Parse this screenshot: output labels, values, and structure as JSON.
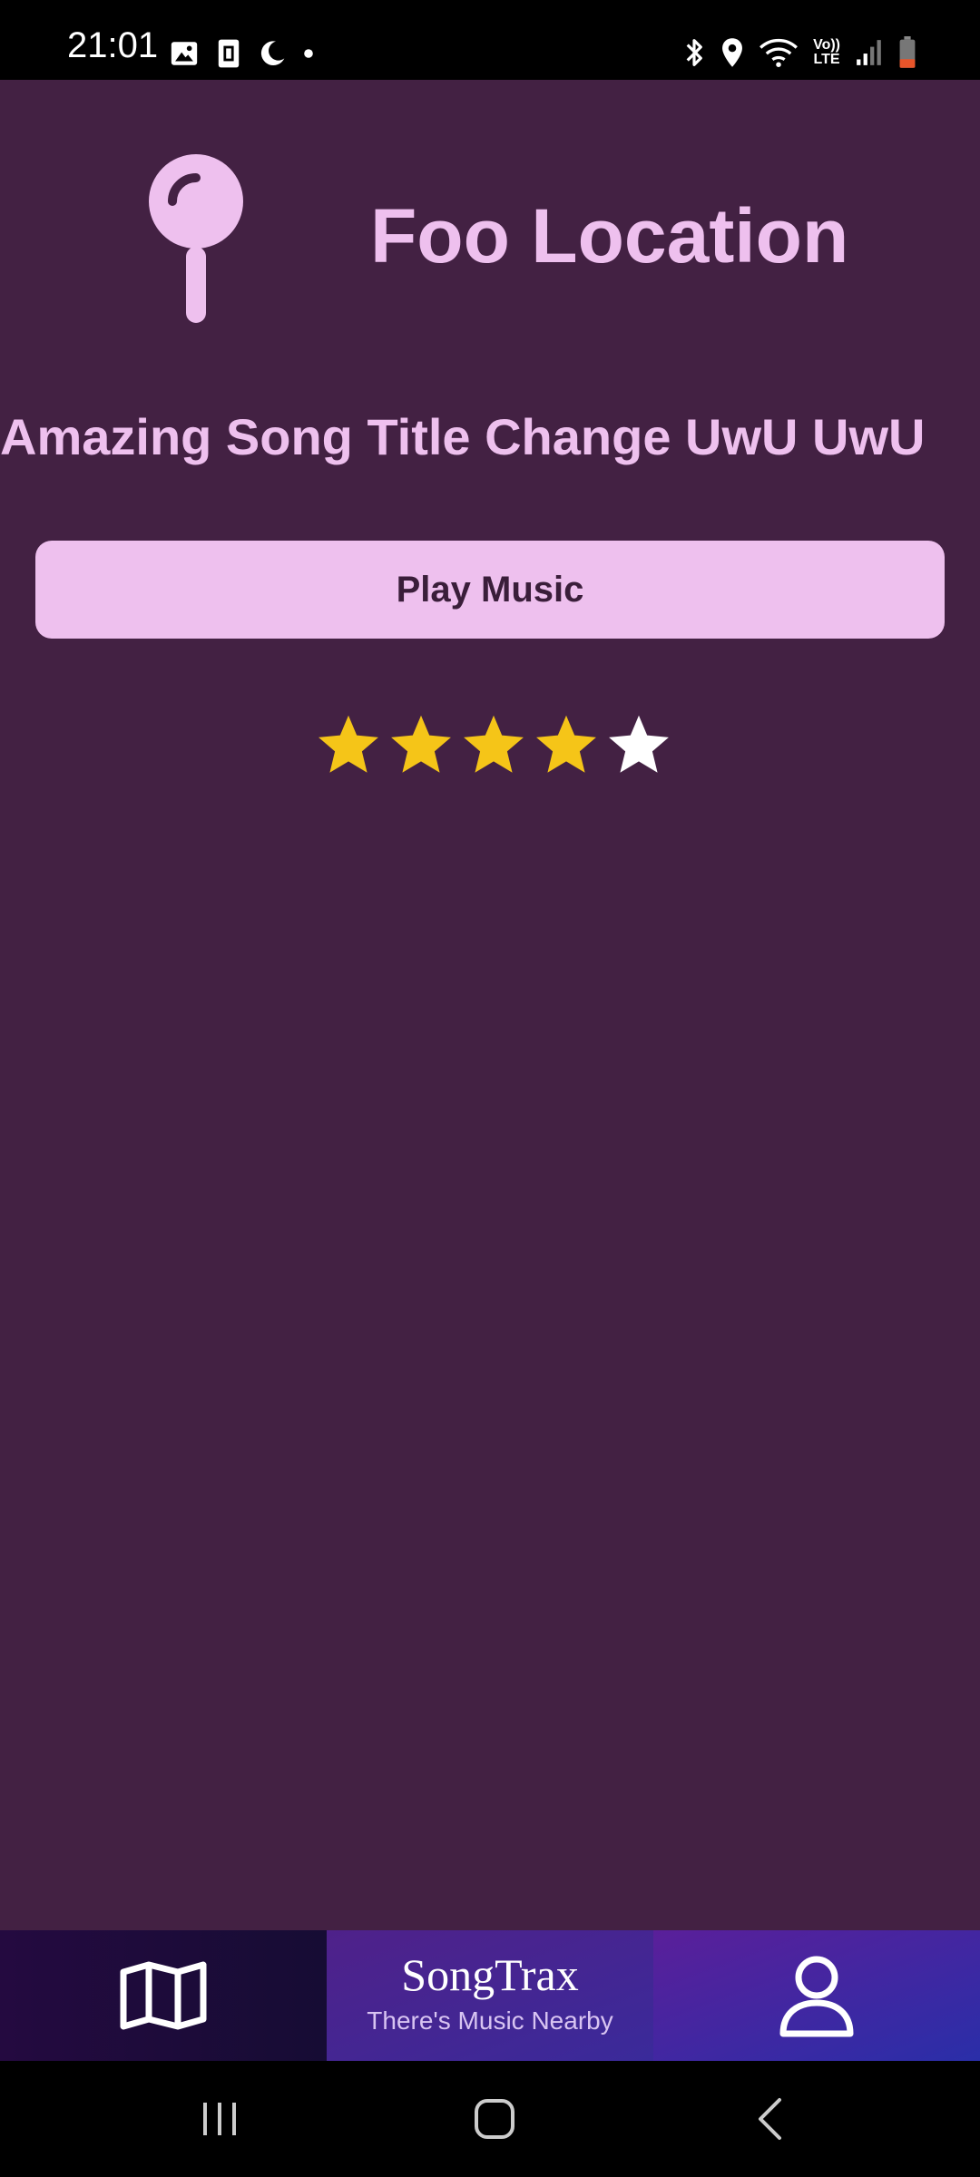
{
  "status_bar": {
    "time": "21:01",
    "left_icons": [
      "gallery-icon",
      "sim-card-icon",
      "moon-icon",
      "dot-icon"
    ],
    "right_icons": [
      "bluetooth-icon",
      "location-icon",
      "wifi-icon",
      "volte-icon",
      "signal-icon",
      "battery-icon"
    ],
    "volte_label_top": "Vo))",
    "volte_label_bottom": "LTE"
  },
  "location": {
    "icon": "map-pin-icon",
    "title": "Foo Location"
  },
  "song": {
    "title": "Amazing Song Title Change UwU UwU"
  },
  "play_button": {
    "label": "Play Music"
  },
  "rating": {
    "value": 4,
    "max": 5
  },
  "bottom_bar": {
    "map_icon": "map-icon",
    "brand_name": "SongTrax",
    "brand_tagline": "There's Music Nearby",
    "profile_icon": "profile-icon"
  },
  "nav_bar": {
    "buttons": [
      "recent-apps-icon",
      "home-icon",
      "back-icon"
    ]
  },
  "colors": {
    "background": "#432143",
    "accent": "#eec0ee",
    "star_filled": "#f5c518",
    "star_empty": "#ffffff"
  }
}
